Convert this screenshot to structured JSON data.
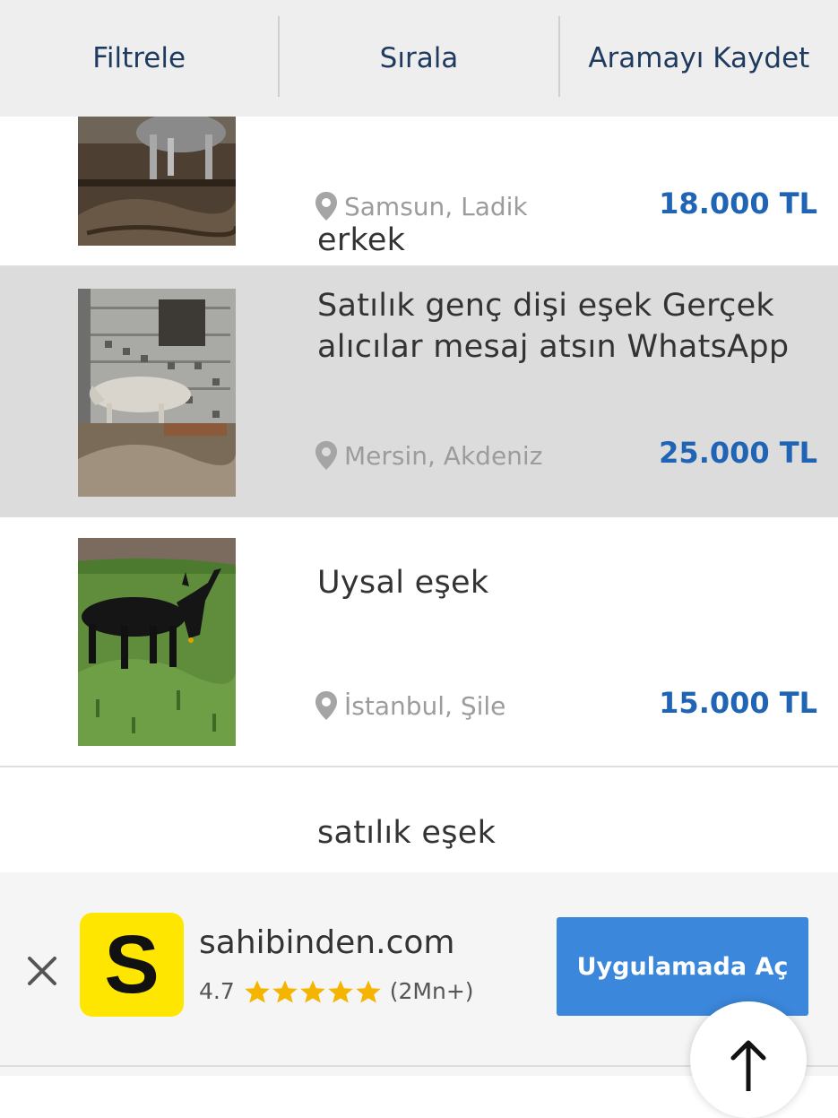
{
  "topbar": {
    "filter_label": "Filtrele",
    "sort_label": "Sırala",
    "save_search_label": "Aramayı Kaydet"
  },
  "listings": [
    {
      "title": "erkek",
      "location": "Samsun, Ladik",
      "price": "18.000 TL",
      "image_icon": "donkey-photo-icon"
    },
    {
      "title": "Satılık genç dişi eşek Gerçek alıcılar mesaj atsın WhatsApp",
      "location": "Mersin, Akdeniz",
      "price": "25.000 TL",
      "image_icon": "donkey-photo-icon",
      "highlighted": true
    },
    {
      "title": "Uysal eşek",
      "location": "İstanbul, Şile",
      "price": "15.000 TL",
      "image_icon": "donkey-photo-icon"
    },
    {
      "title": "satılık eşek",
      "image_icon": "donkey-photo-icon"
    }
  ],
  "app_banner": {
    "logo_letter": "S",
    "app_name": "sahibinden.com",
    "rating": "4.7",
    "star_count": 5,
    "review_count": "(2Mn+)",
    "open_button_label": "Uygulamada Aç",
    "close_icon": "close-icon"
  },
  "colors": {
    "topbar_bg": "#eeeeee",
    "topbar_text": "#1f3a5f",
    "price": "#1f64b5",
    "highlight_row": "#dcdcdc",
    "logo_bg": "#ffe600",
    "cta_bg": "#3b87dc",
    "star": "#f5b400"
  }
}
